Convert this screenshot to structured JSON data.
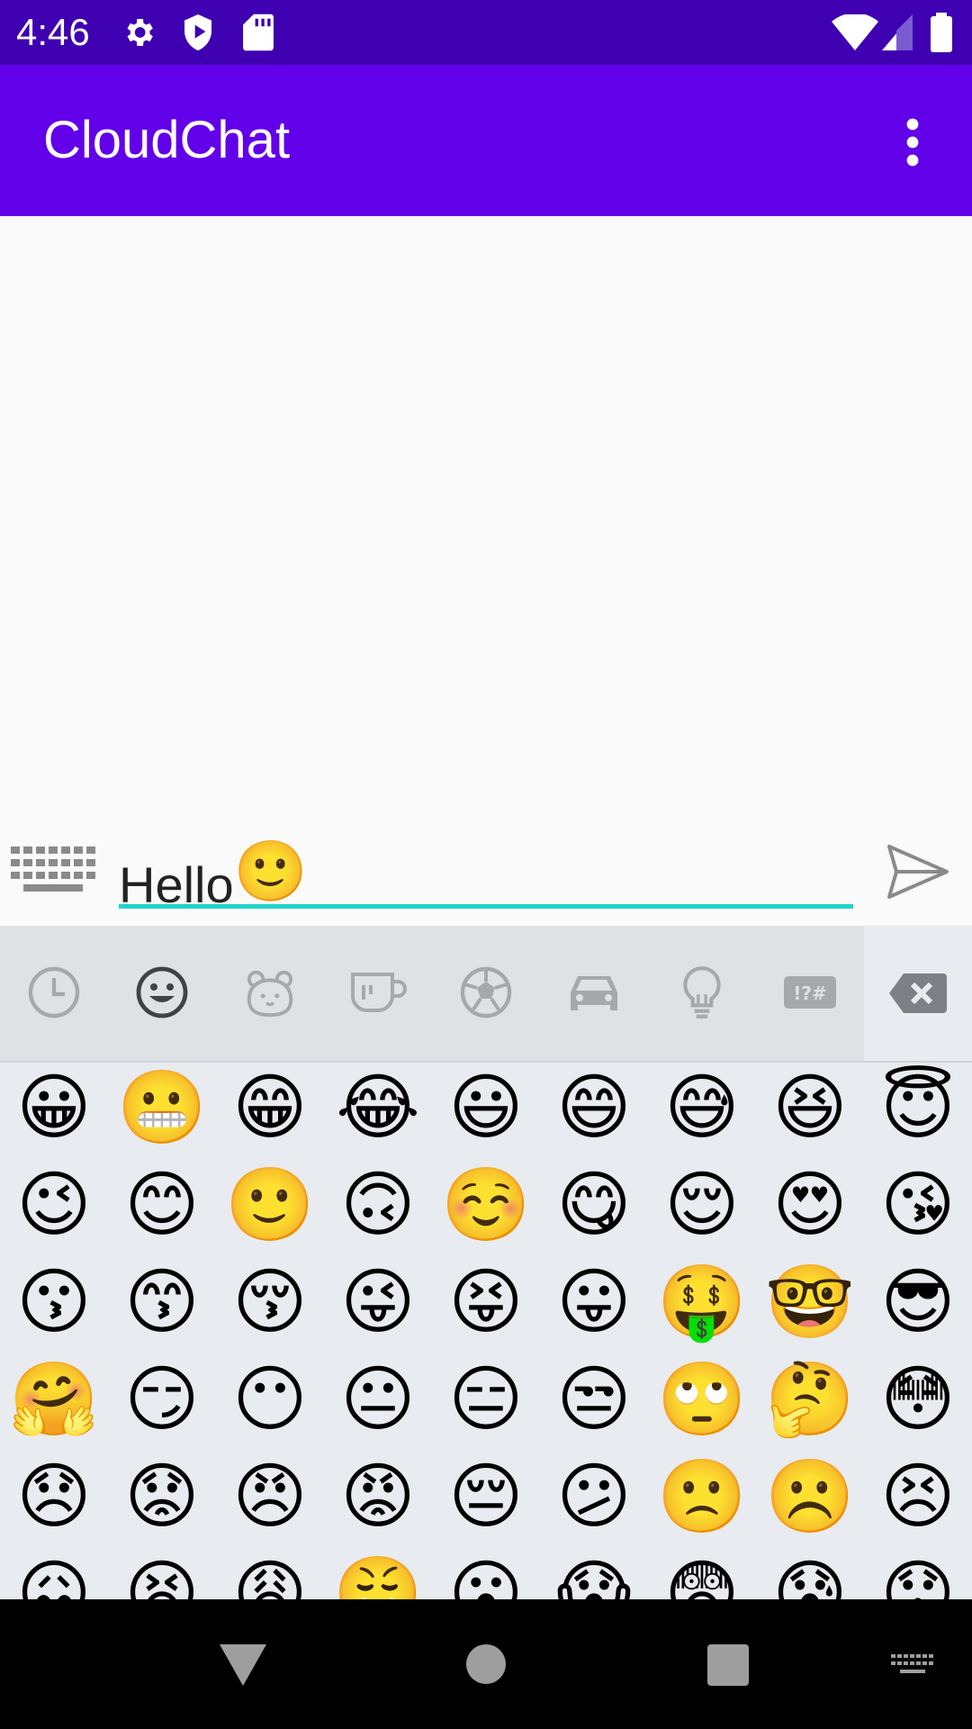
{
  "status_bar": {
    "time": "4:46",
    "icons": [
      "settings-icon",
      "shield-icon",
      "sd-card-icon",
      "wifi-icon",
      "signal-icon",
      "battery-icon"
    ]
  },
  "app_bar": {
    "title": "CloudChat",
    "menu_icon": "more-vert-icon"
  },
  "composer": {
    "keyboard_toggle_icon": "keyboard-icon",
    "message_text": "Hello",
    "message_emoji": "🙂",
    "send_icon": "send-icon"
  },
  "emoji_keyboard": {
    "categories": [
      "recent-icon",
      "smileys-icon",
      "animals-icon",
      "food-icon",
      "sports-icon",
      "travel-icon",
      "objects-icon",
      "symbols-icon"
    ],
    "active_category": "smileys-icon",
    "symbols_label": "!?#",
    "backspace_icon": "backspace-icon",
    "rows": [
      [
        "😀",
        "😬",
        "😁",
        "😂",
        "😃",
        "😄",
        "😅",
        "😆",
        "😇"
      ],
      [
        "😉",
        "😊",
        "🙂",
        "🙃",
        "☺️",
        "😋",
        "😌",
        "😍",
        "😘"
      ],
      [
        "😗",
        "😙",
        "😚",
        "😜",
        "😝",
        "😛",
        "🤑",
        "🤓",
        "😎"
      ],
      [
        "🤗",
        "😏",
        "😶",
        "😐",
        "😑",
        "😒",
        "🙄",
        "🤔",
        "😳"
      ],
      [
        "😞",
        "😟",
        "😠",
        "😡",
        "😔",
        "😕",
        "🙁",
        "☹️",
        "😣"
      ],
      [
        "😖",
        "😫",
        "😩",
        "😤",
        "😮",
        "😱",
        "😨",
        "😰",
        "😯"
      ]
    ]
  },
  "nav_bar": {
    "icons": [
      "back-icon",
      "home-icon",
      "recents-icon",
      "keyboard-switch-icon"
    ]
  },
  "colors": {
    "status_bar": "#3f00b2",
    "app_bar": "#6200ea",
    "input_underline": "#20d3c8",
    "panel_bg": "#e8ebef"
  }
}
